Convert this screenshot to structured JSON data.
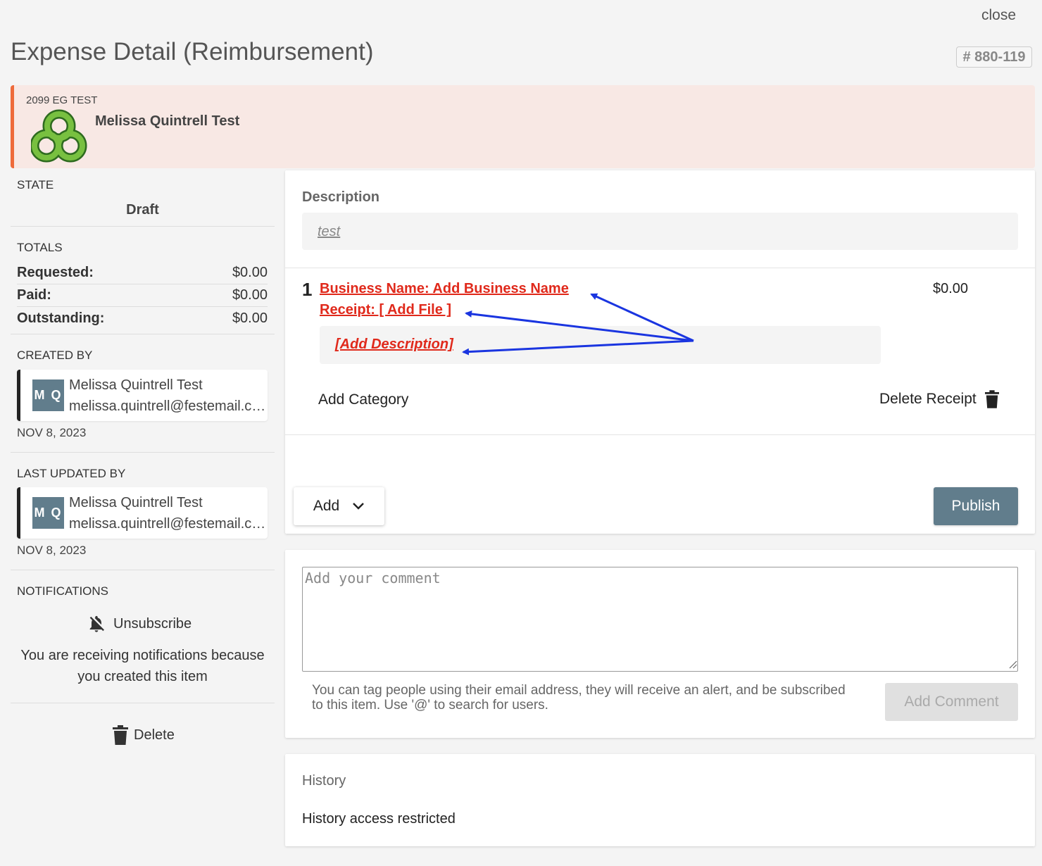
{
  "header": {
    "close_label": "close",
    "title": "Expense Detail (Reimbursement)",
    "reference": "# 880-119"
  },
  "banner": {
    "org": "2099 EG TEST",
    "owner_name": "Melissa Quintrell Test",
    "accent_color": "#ee6a3a",
    "background_color": "#f8e8e4"
  },
  "sidebar": {
    "state_label": "STATE",
    "state_value": "Draft",
    "totals_label": "TOTALS",
    "totals": [
      {
        "label": "Requested:",
        "value": "$0.00"
      },
      {
        "label": "Paid:",
        "value": "$0.00"
      },
      {
        "label": "Outstanding:",
        "value": "$0.00"
      }
    ],
    "created_by": {
      "label": "CREATED BY",
      "initials": "M Q",
      "name": "Melissa Quintrell Test",
      "email": "melissa.quintrell@festemail.com",
      "date": "NOV 8, 2023"
    },
    "updated_by": {
      "label": "LAST UPDATED BY",
      "initials": "M Q",
      "name": "Melissa Quintrell Test",
      "email": "melissa.quintrell@festemail.com",
      "date": "NOV 8, 2023"
    },
    "notifications": {
      "label": "NOTIFICATIONS",
      "unsubscribe_label": "Unsubscribe",
      "message": "You are receiving notifications because you created this item",
      "icon": "bell-off-icon"
    },
    "delete_label": "Delete"
  },
  "main": {
    "description_label": "Description",
    "description_value": "test",
    "item": {
      "number": "1",
      "business_name": "Business Name: Add Business Name",
      "receipt": "Receipt: [ Add File ]",
      "amount": "$0.00",
      "add_description": "[Add Description]",
      "add_category": "Add Category",
      "delete_receipt": "Delete Receipt"
    },
    "add_button": "Add",
    "publish_button": "Publish",
    "link_color": "#e0291b",
    "annotation_arrow_color": "#1a35e0"
  },
  "comments": {
    "placeholder": "Add your comment",
    "hint": "You can tag people using their email address, they will receive an alert, and be subscribed to this item. Use '@' to search for users.",
    "add_button": "Add Comment"
  },
  "history": {
    "title": "History",
    "text": "History access restricted"
  }
}
